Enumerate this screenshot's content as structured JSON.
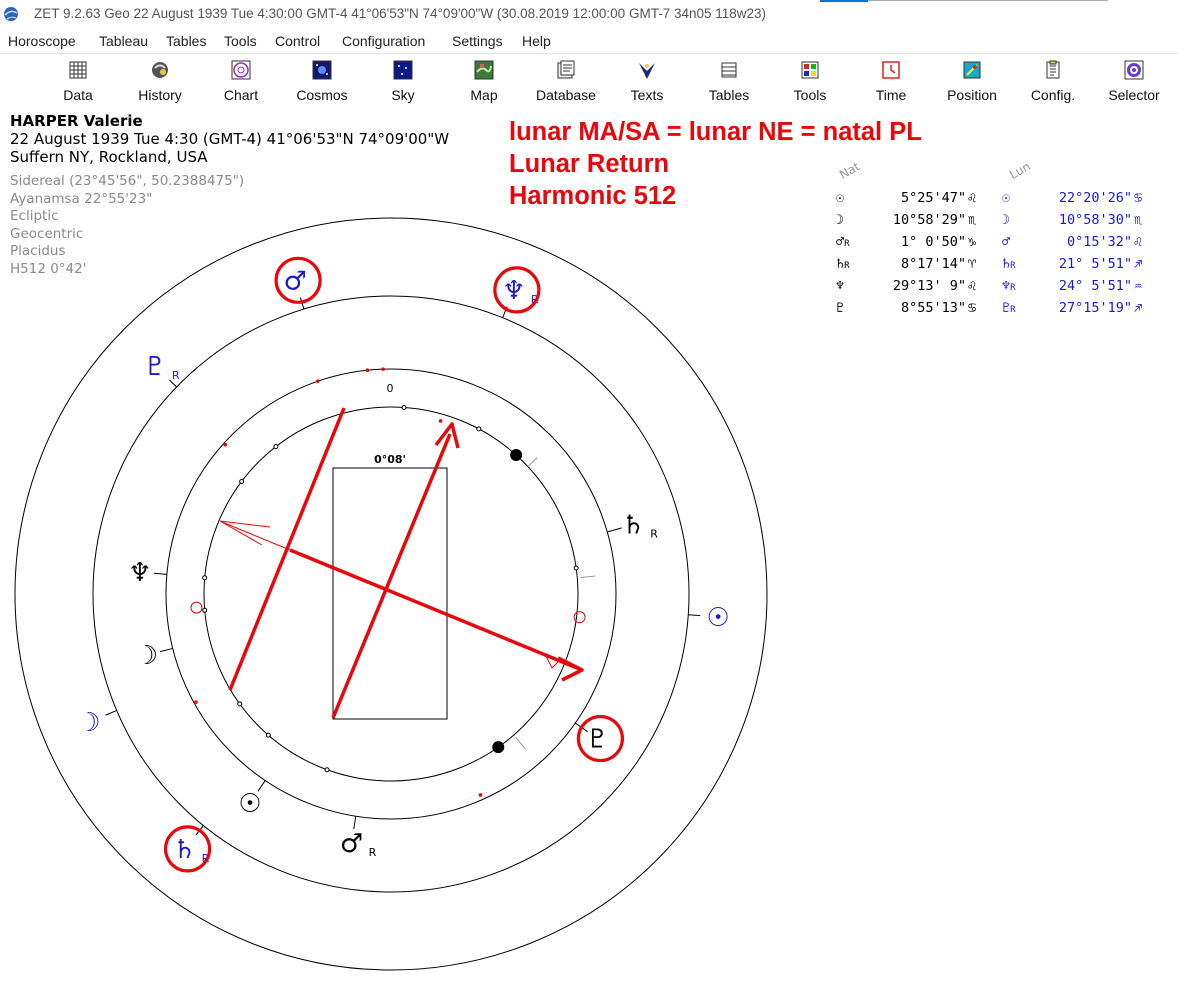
{
  "window": {
    "title": "ZET 9.2.63 Geo    22 August 1939   Tue    4:30:00 GMT-4 41°06'53\"N  74°09'00\"W   (30.08.2019  12:00:00 GMT-7 34n05 118w23)"
  },
  "menu": [
    "Horoscope",
    "Tableau",
    "Tables",
    "Tools",
    "Control",
    "Configuration",
    "Settings",
    "Help"
  ],
  "toolbar": [
    {
      "label": "Data",
      "icon": "data-icon"
    },
    {
      "label": "History",
      "icon": "history-icon"
    },
    {
      "label": "Chart",
      "icon": "chart-icon"
    },
    {
      "label": "Cosmos",
      "icon": "cosmos-icon"
    },
    {
      "label": "Sky",
      "icon": "sky-icon"
    },
    {
      "label": "Map",
      "icon": "map-icon"
    },
    {
      "label": "Database",
      "icon": "database-icon"
    },
    {
      "label": "Texts",
      "icon": "texts-icon"
    },
    {
      "label": "Tables",
      "icon": "tables-icon"
    },
    {
      "label": "Tools",
      "icon": "tools-icon"
    },
    {
      "label": "Time",
      "icon": "time-icon"
    },
    {
      "label": "Position",
      "icon": "position-icon"
    },
    {
      "label": "Config.",
      "icon": "config-icon"
    },
    {
      "label": "Selector",
      "icon": "selector-icon"
    }
  ],
  "person": {
    "name": "HARPER Valerie",
    "datetime": "22 August 1939  Tue   4:30 (GMT-4) 41°06'53\"N  74°09'00\"W",
    "place": "Suffern NY, Rockland, USA"
  },
  "settings": [
    "Sidereal (23°45'56\", 50.2388475\")",
    "Ayanamsa 22°55'23\"",
    "Ecliptic",
    "Geocentric",
    "Placidus",
    "H512   0°42'"
  ],
  "annotation": [
    "lunar MA/SA = lunar NE = natal PL",
    "Lunar Return",
    "Harmonic 512"
  ],
  "colors": {
    "annotation": "#e8070b",
    "lunar": "#1a1acc",
    "natal": "#000000",
    "aspect_line": "#e8070b"
  },
  "table": {
    "natal_header": "Nat",
    "lunar_header": "Lun",
    "natal": [
      {
        "glyph": "☉",
        "r": false,
        "value": "5°25'47\"",
        "sign": "♌"
      },
      {
        "glyph": "☽",
        "r": false,
        "value": "10°58'29\"",
        "sign": "♏"
      },
      {
        "glyph": "♂",
        "r": true,
        "value": "1° 0'50\"",
        "sign": "♑"
      },
      {
        "glyph": "♄",
        "r": true,
        "value": "8°17'14\"",
        "sign": "♈"
      },
      {
        "glyph": "♆",
        "r": false,
        "value": "29°13' 9\"",
        "sign": "♌"
      },
      {
        "glyph": "♇",
        "r": false,
        "value": "8°55'13\"",
        "sign": "♋"
      }
    ],
    "lunar": [
      {
        "glyph": "☉",
        "r": false,
        "value": "22°20'26\"",
        "sign": "♋"
      },
      {
        "glyph": "☽",
        "r": false,
        "value": "10°58'30\"",
        "sign": "♏"
      },
      {
        "glyph": "♂",
        "r": false,
        "value": "0°15'32\"",
        "sign": "♌"
      },
      {
        "glyph": "♄",
        "r": true,
        "value": "21° 5'51\"",
        "sign": "♐"
      },
      {
        "glyph": "♆",
        "r": true,
        "value": "24° 5'51\"",
        "sign": "♒"
      },
      {
        "glyph": "♇",
        "r": true,
        "value": "27°15'19\"",
        "sign": "♐"
      }
    ]
  },
  "chart": {
    "top_label": "0",
    "orb_label": "0°08'",
    "retro_marker": "R",
    "lunar_planets": [
      {
        "glyph": "♂",
        "angle": -17,
        "retro": false,
        "circled": true
      },
      {
        "glyph": "♆",
        "angle": 22,
        "retro": true,
        "circled": true
      },
      {
        "glyph": "♇",
        "angle": -46,
        "retro": true,
        "circled": false
      },
      {
        "glyph": "☉",
        "angle": 94,
        "retro": false,
        "circled": false
      },
      {
        "glyph": "☽",
        "angle": -113,
        "retro": false,
        "circled": false
      },
      {
        "glyph": "♄",
        "angle": -141,
        "retro": true,
        "circled": true
      }
    ],
    "natal_planets": [
      {
        "glyph": "♄",
        "angle": 74,
        "retro": true,
        "circled": false
      },
      {
        "glyph": "♇",
        "angle": 125,
        "retro": false,
        "circled": true
      },
      {
        "glyph": "♂",
        "angle": -171,
        "retro": true,
        "circled": false
      },
      {
        "glyph": "☉",
        "angle": -146,
        "retro": false,
        "circled": false
      },
      {
        "glyph": "☽",
        "angle": -104,
        "retro": false,
        "circled": false
      },
      {
        "glyph": "♆",
        "angle": -85,
        "retro": false,
        "circled": false
      }
    ]
  }
}
